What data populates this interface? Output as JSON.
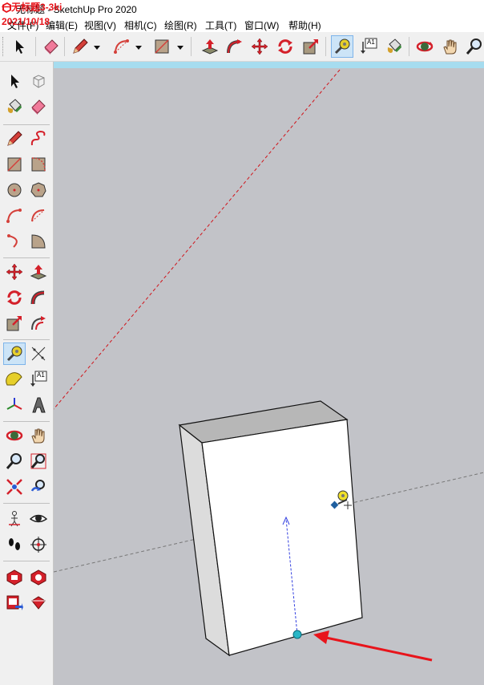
{
  "window": {
    "title": "无标题 - SketchUp Pro 2020",
    "watermark_name": "一无标题3-3ki",
    "watermark_date": "2021/10/18"
  },
  "menu": [
    {
      "label": "文件(F)"
    },
    {
      "label": "编辑(E)"
    },
    {
      "label": "视图(V)"
    },
    {
      "label": "相机(C)"
    },
    {
      "label": "绘图(R)"
    },
    {
      "label": "工具(T)"
    },
    {
      "label": "窗口(W)"
    },
    {
      "label": "帮助(H)"
    }
  ],
  "toolbar": {
    "text_tool_glyph": "A1",
    "active_tool": "tape-measure"
  },
  "left_toolbar": {
    "text_tool_glyph": "A1",
    "active_tool": "tape-measure"
  },
  "colors": {
    "viewport_bg": "#c2c3c8",
    "viewport_top_strip": "#a6dcef",
    "red_axis": "#d0141b",
    "active_tool_bg": "#cce4f7",
    "annotation_arrow": "#e8141b",
    "guide_point": "#29b6c6",
    "guide_line": "#3340e0"
  }
}
